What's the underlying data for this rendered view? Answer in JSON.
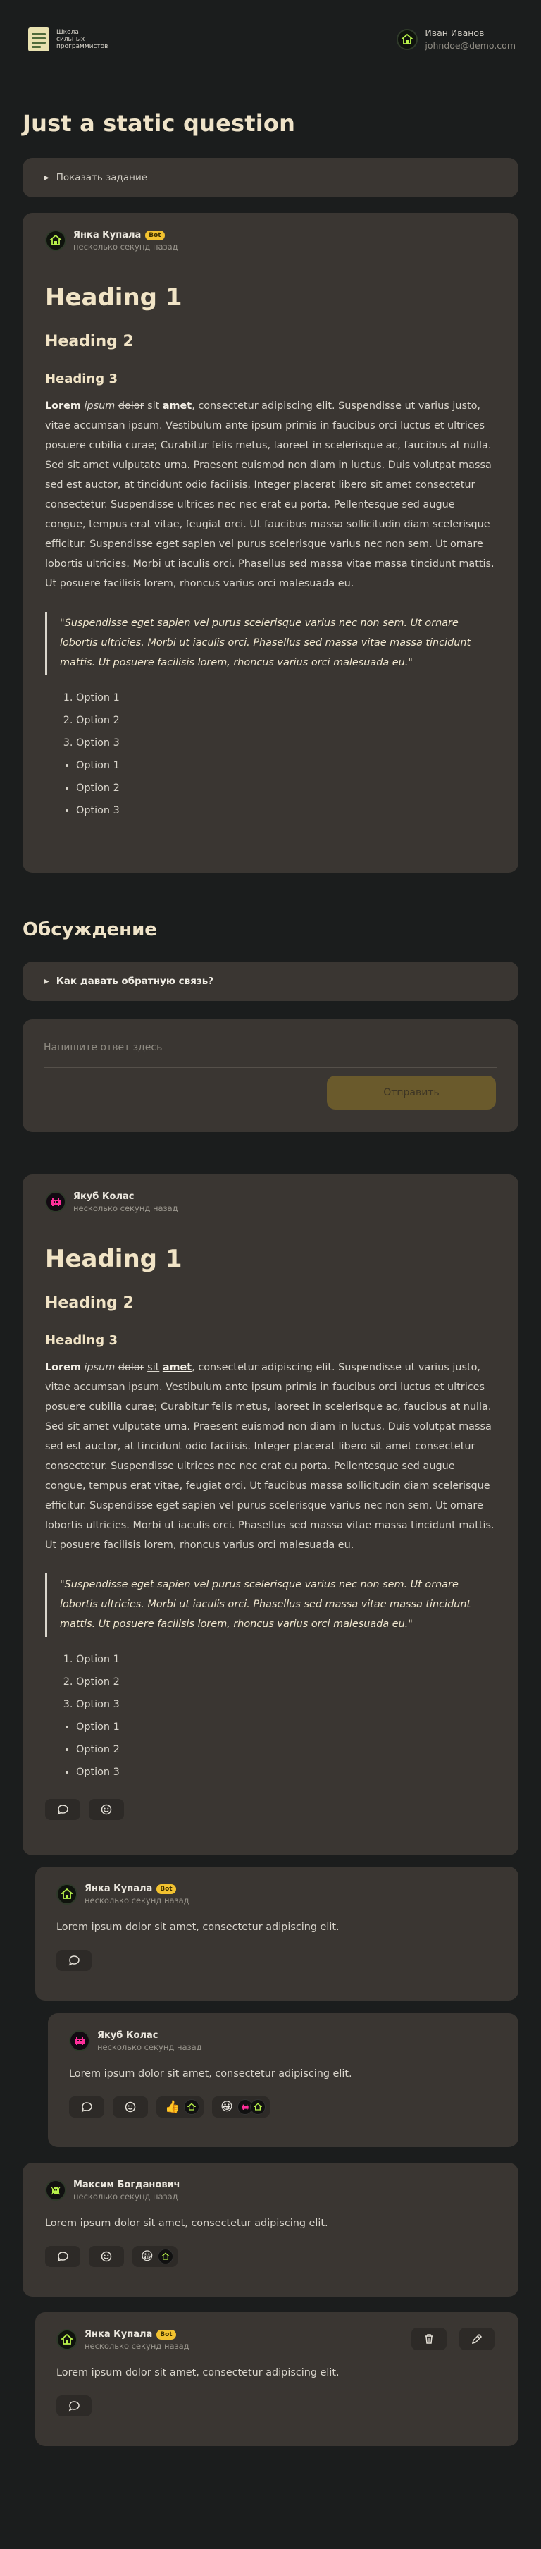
{
  "header": {
    "logo_text": "Школа\nсильных\nпрограммистов",
    "user_name": "Иван Иванов",
    "user_email": "johndoe@demo.com"
  },
  "page_title": "Just a static question",
  "task_toggle": "Показать задание",
  "question_card": {
    "author": "Янка Купала",
    "badge": "Bot",
    "time": "несколько секунд назад"
  },
  "rich": {
    "h1": "Heading 1",
    "h2": "Heading 2",
    "h3": "Heading 3",
    "lorem_bold": "Lorem",
    "lorem_italic": "ipsum",
    "lorem_strike": "dolor",
    "lorem_underline": "sit",
    "lorem_bold_underline": "amet",
    "lorem_rest": ", consectetur adipiscing elit. Suspendisse ut varius justo, vitae accumsan ipsum. Vestibulum ante ipsum primis in faucibus orci luctus et ultrices posuere cubilia curae; Curabitur felis metus, laoreet in scelerisque ac, faucibus at nulla. Sed sit amet vulputate urna. Praesent euismod non diam in luctus. Duis volutpat massa sed est auctor, at tincidunt odio facilisis. Integer placerat libero sit amet consectetur consectetur. Suspendisse ultrices nec nec erat eu porta. Pellentesque sed augue congue, tempus erat vitae, feugiat orci. Ut faucibus massa sollicitudin diam scelerisque efficitur. Suspendisse eget sapien vel purus scelerisque varius nec non sem. Ut ornare lobortis ultricies. Morbi ut iaculis orci. Phasellus sed massa vitae massa tincidunt mattis. Ut posuere facilisis lorem, rhoncus varius orci malesuada eu.",
    "quote": "\"Suspendisse eget sapien vel purus scelerisque varius nec non sem. Ut ornare lobortis ultricies. Morbi ut iaculis orci. Phasellus sed massa vitae massa tincidunt mattis. Ut posuere facilisis lorem, rhoncus varius orci malesuada eu.\"",
    "ordered": [
      "Option 1",
      "Option 2",
      "Option 3"
    ],
    "unordered": [
      "Option 1",
      "Option 2",
      "Option 3"
    ]
  },
  "discussion_title": "Обсуждение",
  "feedback_toggle": "Как давать обратную связь?",
  "answer_form": {
    "placeholder": "Напишите ответ здесь",
    "send": "Отправить"
  },
  "comment1": {
    "author": "Якуб Колас",
    "time": "несколько секунд назад"
  },
  "reply1": {
    "author": "Янка Купала",
    "badge": "Bot",
    "time": "несколько секунд назад",
    "text": "Lorem ipsum dolor sit amet, consectetur adipiscing elit."
  },
  "reply2": {
    "author": "Якуб Колас",
    "time": "несколько секунд назад",
    "text": "Lorem ipsum dolor sit amet, consectetur adipiscing elit.",
    "reactions": [
      "👍",
      "😀"
    ]
  },
  "comment2": {
    "author": "Максим Богданович",
    "time": "несколько секунд назад",
    "text": "Lorem ipsum dolor sit amet, consectetur adipiscing elit.",
    "reactions": [
      "😀"
    ]
  },
  "reply3": {
    "author": "Янка Купала",
    "badge": "Bot",
    "time": "несколько секунд назад",
    "text": "Lorem ipsum dolor sit amet, consectetur adipiscing elit."
  },
  "icons": {
    "comment": "comment-icon",
    "emoji": "emoji-icon",
    "delete": "trash-icon",
    "edit": "pencil-icon"
  },
  "colors": {
    "bg": "#1b1d1d",
    "card": "#3a3632",
    "accent": "#f2c230",
    "heading": "#f1e4c6"
  }
}
